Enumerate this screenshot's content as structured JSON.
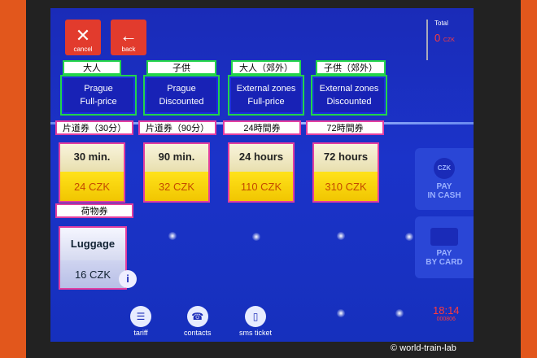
{
  "top_buttons": {
    "cancel_label": "cancel",
    "back_label": "back"
  },
  "total": {
    "label": "Total",
    "value": "0",
    "currency": "CZK"
  },
  "passenger_types": [
    {
      "jp": "大人",
      "line1": "Prague",
      "line2": "Full-price"
    },
    {
      "jp": "子供",
      "line1": "Prague",
      "line2": "Discounted"
    },
    {
      "jp": "大人（郊外）",
      "line1": "External zones",
      "line2": "Full-price"
    },
    {
      "jp": "子供（郊外）",
      "line1": "External zones",
      "line2": "Discounted"
    }
  ],
  "tickets": [
    {
      "jp": "片道券（30分）",
      "duration": "30 min.",
      "price": "24 CZK"
    },
    {
      "jp": "片道券（90分）",
      "duration": "90 min.",
      "price": "32 CZK"
    },
    {
      "jp": "24時間券",
      "duration": "24 hours",
      "price": "110 CZK"
    },
    {
      "jp": "72時間券",
      "duration": "72 hours",
      "price": "310 CZK"
    }
  ],
  "luggage": {
    "jp": "荷物券",
    "name": "Luggage",
    "price": "16 CZK"
  },
  "pay": {
    "cash_icon": "CZK",
    "cash_line1": "PAY",
    "cash_line2": "IN CASH",
    "card_line1": "PAY",
    "card_line2": "BY CARD"
  },
  "bottom": {
    "tariff": "tariff",
    "contacts": "contacts",
    "sms": "sms ticket"
  },
  "clock": {
    "time": "18:14",
    "machine": "000806"
  },
  "watermark": "© world-train-lab"
}
